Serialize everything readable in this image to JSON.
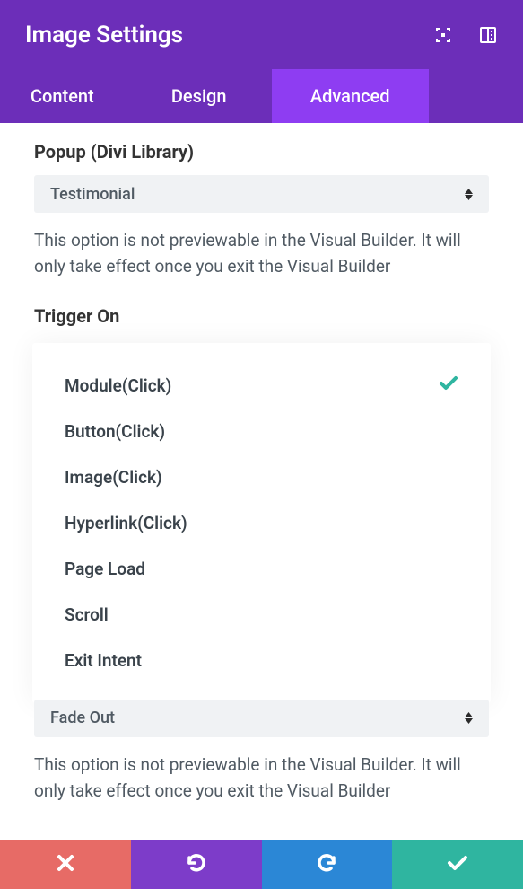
{
  "header": {
    "title": "Image Settings"
  },
  "tabs": {
    "content": "Content",
    "design": "Design",
    "advanced": "Advanced"
  },
  "popup": {
    "label": "Popup (Divi Library)",
    "value": "Testimonial",
    "help": "This option is not previewable in the Visual Builder. It will only take effect once you exit the Visual Builder"
  },
  "trigger": {
    "label": "Trigger On",
    "items": [
      "Module(Click)",
      "Button(Click)",
      "Image(Click)",
      "Hyperlink(Click)",
      "Page Load",
      "Scroll",
      "Exit Intent"
    ],
    "selected_index": 0
  },
  "animation": {
    "value": "Fade Out",
    "help": "This option is not previewable in the Visual Builder. It will only take effect once you exit the Visual Builder"
  }
}
